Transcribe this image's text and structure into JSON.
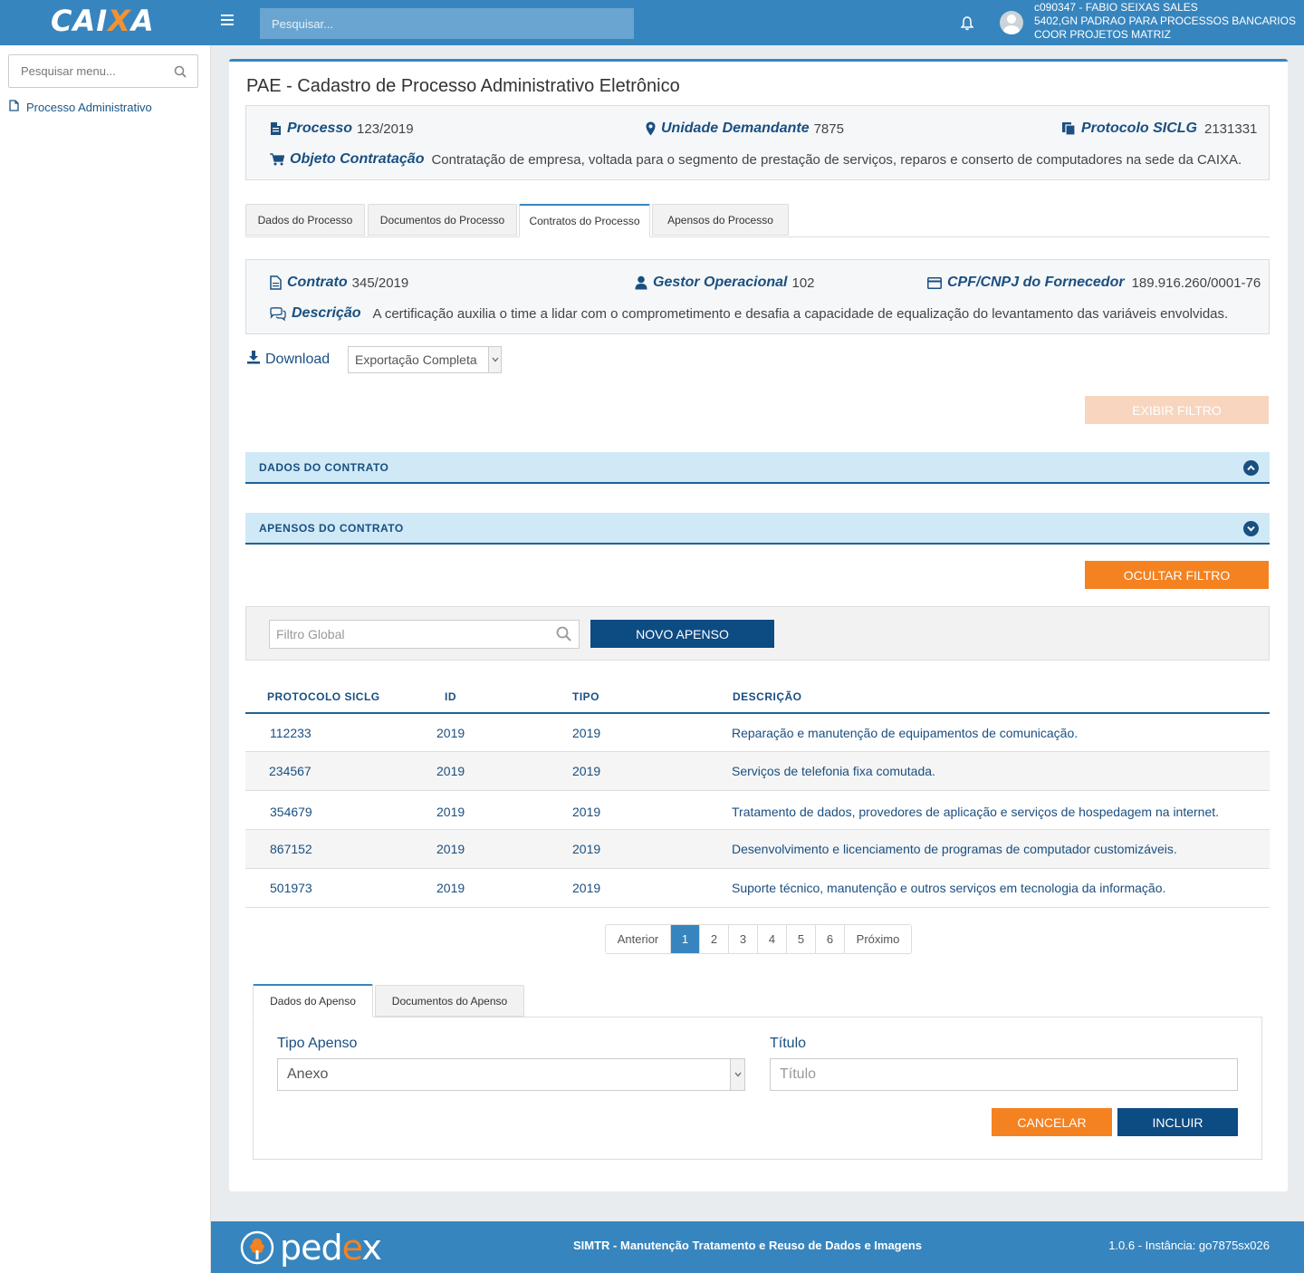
{
  "topbar": {
    "logo_main": "CAI",
    "logo_x": "X",
    "logo_end": "A",
    "search_placeholder": "Pesquisar...",
    "user_line1": "c090347 - FABIO SEIXAS SALES",
    "user_line2": "5402,GN PADRAO PARA PROCESSOS BANCARIOS",
    "user_line3": "COOR PROJETOS MATRIZ"
  },
  "sidebar": {
    "search_placeholder": "Pesquisar menu...",
    "items": [
      {
        "label": "Processo Administrativo"
      }
    ]
  },
  "page": {
    "title": "PAE - Cadastro de Processo Administrativo Eletrônico"
  },
  "process_info": {
    "processo_label": "Processo",
    "processo_value": "123/2019",
    "unidade_label": "Unidade Demandante",
    "unidade_value": "7875",
    "protocolo_label": "Protocolo SICLG",
    "protocolo_value": "2131331",
    "objeto_label": "Objeto Contratação",
    "objeto_value": "Contratação  de  empresa, voltada para o segmento de prestação de serviços, reparos e  conserto de computadores na sede da CAIXA."
  },
  "tabs": [
    {
      "label": "Dados do Processo"
    },
    {
      "label": "Documentos do Processo"
    },
    {
      "label": "Contratos do Processo",
      "active": true
    },
    {
      "label": "Apensos do Processo"
    }
  ],
  "contract_info": {
    "contrato_label": "Contrato",
    "contrato_value": "345/2019",
    "gestor_label": "Gestor Operacional",
    "gestor_value": "102",
    "cpf_label": "CPF/CNPJ do Fornecedor",
    "cpf_value": "189.916.260/0001-76",
    "descricao_label": "Descrição",
    "descricao_value": "A certificação auxilia o time a lidar com o comprometimento e desafia a capacidade de equalização do levantamento das variáveis envolvidas."
  },
  "download": {
    "label": "Download",
    "selected": "Exportação Completa"
  },
  "buttons": {
    "exibir_filtro": "EXIBIR FILTRO",
    "ocultar_filtro": "OCULTAR FILTRO",
    "novo_apenso": "NOVO APENSO",
    "cancelar": "CANCELAR",
    "incluir": "INCLUIR"
  },
  "accordions": {
    "dados_contrato": "DADOS DO CONTRATO",
    "apensos_contrato": "APENSOS DO CONTRATO"
  },
  "filter": {
    "placeholder": "Filtro Global"
  },
  "table": {
    "headers": [
      "PROTOCOLO SICLG",
      "ID",
      "TIPO",
      "DESCRIÇÃO"
    ],
    "rows": [
      {
        "protocolo": "112233",
        "id": "2019",
        "tipo": "2019",
        "descricao": "Reparação e manutenção de equipamentos de comunicação."
      },
      {
        "protocolo": "234567",
        "id": "2019",
        "tipo": "2019",
        "descricao": "Serviços de telefonia fixa comutada."
      },
      {
        "protocolo": "354679",
        "id": "2019",
        "tipo": "2019",
        "descricao": "Tratamento de dados, provedores de aplicação e serviços de hospedagem na internet."
      },
      {
        "protocolo": "867152",
        "id": "2019",
        "tipo": "2019",
        "descricao": "Desenvolvimento e licenciamento de programas de computador customizáveis."
      },
      {
        "protocolo": "501973",
        "id": "2019",
        "tipo": "2019",
        "descricao": "Suporte técnico, manutenção e outros serviços em tecnologia da informação."
      }
    ]
  },
  "pagination": {
    "prev": "Anterior",
    "pages": [
      "1",
      "2",
      "3",
      "4",
      "5",
      "6"
    ],
    "current": "1",
    "next": "Próximo"
  },
  "subtabs": [
    {
      "label": "Dados do Apenso",
      "active": true
    },
    {
      "label": "Documentos do Apenso"
    }
  ],
  "form": {
    "tipo_label": "Tipo Apenso",
    "tipo_value": "Anexo",
    "titulo_label": "Título",
    "titulo_placeholder": "Título"
  },
  "footer": {
    "brand_p": "p",
    "brand_e": "e",
    "brand_d": "d",
    "brand_e2": "e",
    "brand_x": "x",
    "center": "SIMTR - Manutenção Tratamento e Reuso de Dados e Imagens",
    "version": "1.0.6 - Instância: go7875sx026"
  },
  "colors": {
    "primary": "#3785be",
    "navy": "#0d4b83",
    "orange": "#f58220",
    "label_blue": "#1a4f80"
  }
}
